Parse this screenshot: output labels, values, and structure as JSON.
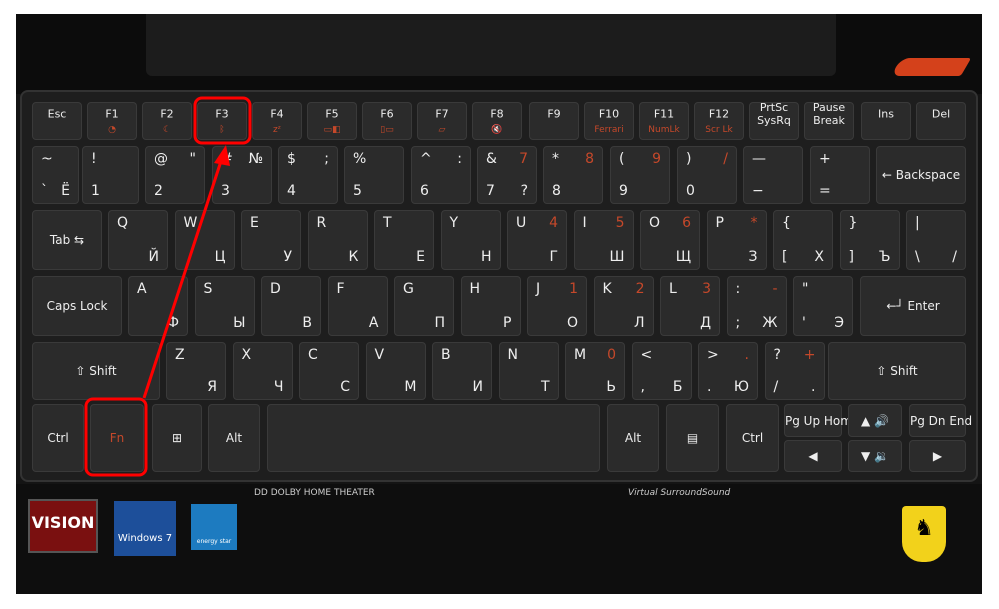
{
  "rows": [
    [
      {
        "c": "Esc"
      },
      {
        "c": "F1",
        "fn": "◔"
      },
      {
        "c": "F2",
        "fn": "☾"
      },
      {
        "c": "F3",
        "fn": "ᛒ"
      },
      {
        "c": "F4",
        "fn": "zᶻ"
      },
      {
        "c": "F5",
        "fn": "▭◧"
      },
      {
        "c": "F6",
        "fn": "▯▭"
      },
      {
        "c": "F7",
        "fn": "▱"
      },
      {
        "c": "F8",
        "fn": "🔇"
      },
      {
        "c": "F9"
      },
      {
        "c": "F10",
        "fn": "Ferrari"
      },
      {
        "c": "F11",
        "fn": "NumLk"
      },
      {
        "c": "F12",
        "fn": "Scr Lk"
      },
      {
        "c": "PrtSc\nSysRq"
      },
      {
        "c": "Pause\nBreak"
      },
      {
        "c": "Ins"
      },
      {
        "c": "Del"
      }
    ],
    [
      {
        "tl": "~",
        "bl": "`",
        "br": "Ё"
      },
      {
        "tl": "!",
        "bl": "1"
      },
      {
        "tl": "@",
        "tr": "\"",
        "bl": "2"
      },
      {
        "tl": "#",
        "tr": "№",
        "bl": "3"
      },
      {
        "tl": "$",
        "tr": ";",
        "bl": "4"
      },
      {
        "tl": "%",
        "bl": "5"
      },
      {
        "tl": "^",
        "tr": ":",
        "bl": "6"
      },
      {
        "tl": "&",
        "o": "7",
        "bl": "7",
        "br": "?"
      },
      {
        "tl": "*",
        "o": "8",
        "bl": "8"
      },
      {
        "tl": "(",
        "o": "9",
        "bl": "9"
      },
      {
        "tl": ")",
        "o": "/",
        "bl": "0"
      },
      {
        "tl": "—",
        "bl": "−"
      },
      {
        "tl": "+",
        "bl": "="
      },
      {
        "c": "← Backspace"
      }
    ],
    [
      {
        "c": "Tab ⇆"
      },
      {
        "tl": "Q",
        "br": "Й"
      },
      {
        "tl": "W",
        "br": "Ц"
      },
      {
        "tl": "E",
        "br": "У"
      },
      {
        "tl": "R",
        "br": "К"
      },
      {
        "tl": "T",
        "br": "Е"
      },
      {
        "tl": "Y",
        "br": "Н"
      },
      {
        "tl": "U",
        "o": "4",
        "br": "Г"
      },
      {
        "tl": "I",
        "o": "5",
        "br": "Ш"
      },
      {
        "tl": "O",
        "o": "6",
        "br": "Щ"
      },
      {
        "tl": "P",
        "o": "*",
        "br": "З"
      },
      {
        "tl": "{",
        "bl": "[",
        "br": "Х"
      },
      {
        "tl": "}",
        "bl": "]",
        "br": "Ъ"
      },
      {
        "tl": "|",
        "bl": "\\",
        "br": "/"
      }
    ],
    [
      {
        "c": "Caps Lock"
      },
      {
        "tl": "A",
        "br": "Ф"
      },
      {
        "tl": "S",
        "br": "Ы"
      },
      {
        "tl": "D",
        "br": "В"
      },
      {
        "tl": "F",
        "br": "А"
      },
      {
        "tl": "G",
        "br": "П"
      },
      {
        "tl": "H",
        "br": "Р"
      },
      {
        "tl": "J",
        "o": "1",
        "br": "О"
      },
      {
        "tl": "K",
        "o": "2",
        "br": "Л"
      },
      {
        "tl": "L",
        "o": "3",
        "br": "Д"
      },
      {
        "tl": ":",
        "o": "-",
        "bl": ";",
        "br": "Ж"
      },
      {
        "tl": "\"",
        "bl": "'",
        "br": "Э"
      },
      {
        "c": "←┘ Enter"
      }
    ],
    [
      {
        "c": "⇧ Shift"
      },
      {
        "tl": "Z",
        "br": "Я"
      },
      {
        "tl": "X",
        "br": "Ч"
      },
      {
        "tl": "C",
        "br": "С"
      },
      {
        "tl": "V",
        "br": "М"
      },
      {
        "tl": "B",
        "br": "И"
      },
      {
        "tl": "N",
        "br": "Т"
      },
      {
        "tl": "M",
        "o": "0",
        "br": "Ь"
      },
      {
        "tl": "<",
        "bl": ",",
        "br": "Б"
      },
      {
        "tl": ">",
        "o": ".",
        "bl": ".",
        "br": "Ю"
      },
      {
        "tl": "?",
        "o": "+",
        "bl": "/",
        "br": "."
      },
      {
        "c": "⇧ Shift"
      }
    ],
    [
      {
        "c": "Ctrl"
      },
      {
        "c": "Fn",
        "orange": true
      },
      {
        "c": "⊞"
      },
      {
        "c": "Alt"
      },
      {
        "c": ""
      },
      {
        "c": "Alt"
      },
      {
        "c": "▤"
      },
      {
        "c": "Ctrl"
      },
      {
        "c": "Pg Up Home"
      },
      {
        "c": "▲ 🔊"
      },
      {
        "c": "Pg Dn End"
      },
      {
        "c": "◀"
      },
      {
        "c": "▼ 🔉"
      },
      {
        "c": "▶"
      }
    ]
  ],
  "logos": {
    "vision": "VISION",
    "win7": "Windows 7",
    "estar": "energy star",
    "ferrari": "♞",
    "dolby": "DD DOLBY HOME THEATER",
    "surround": "Virtual SurroundSound"
  },
  "annotation": {
    "color": "#ff0000",
    "highlighted_keys": [
      "F3",
      "Fn"
    ]
  }
}
